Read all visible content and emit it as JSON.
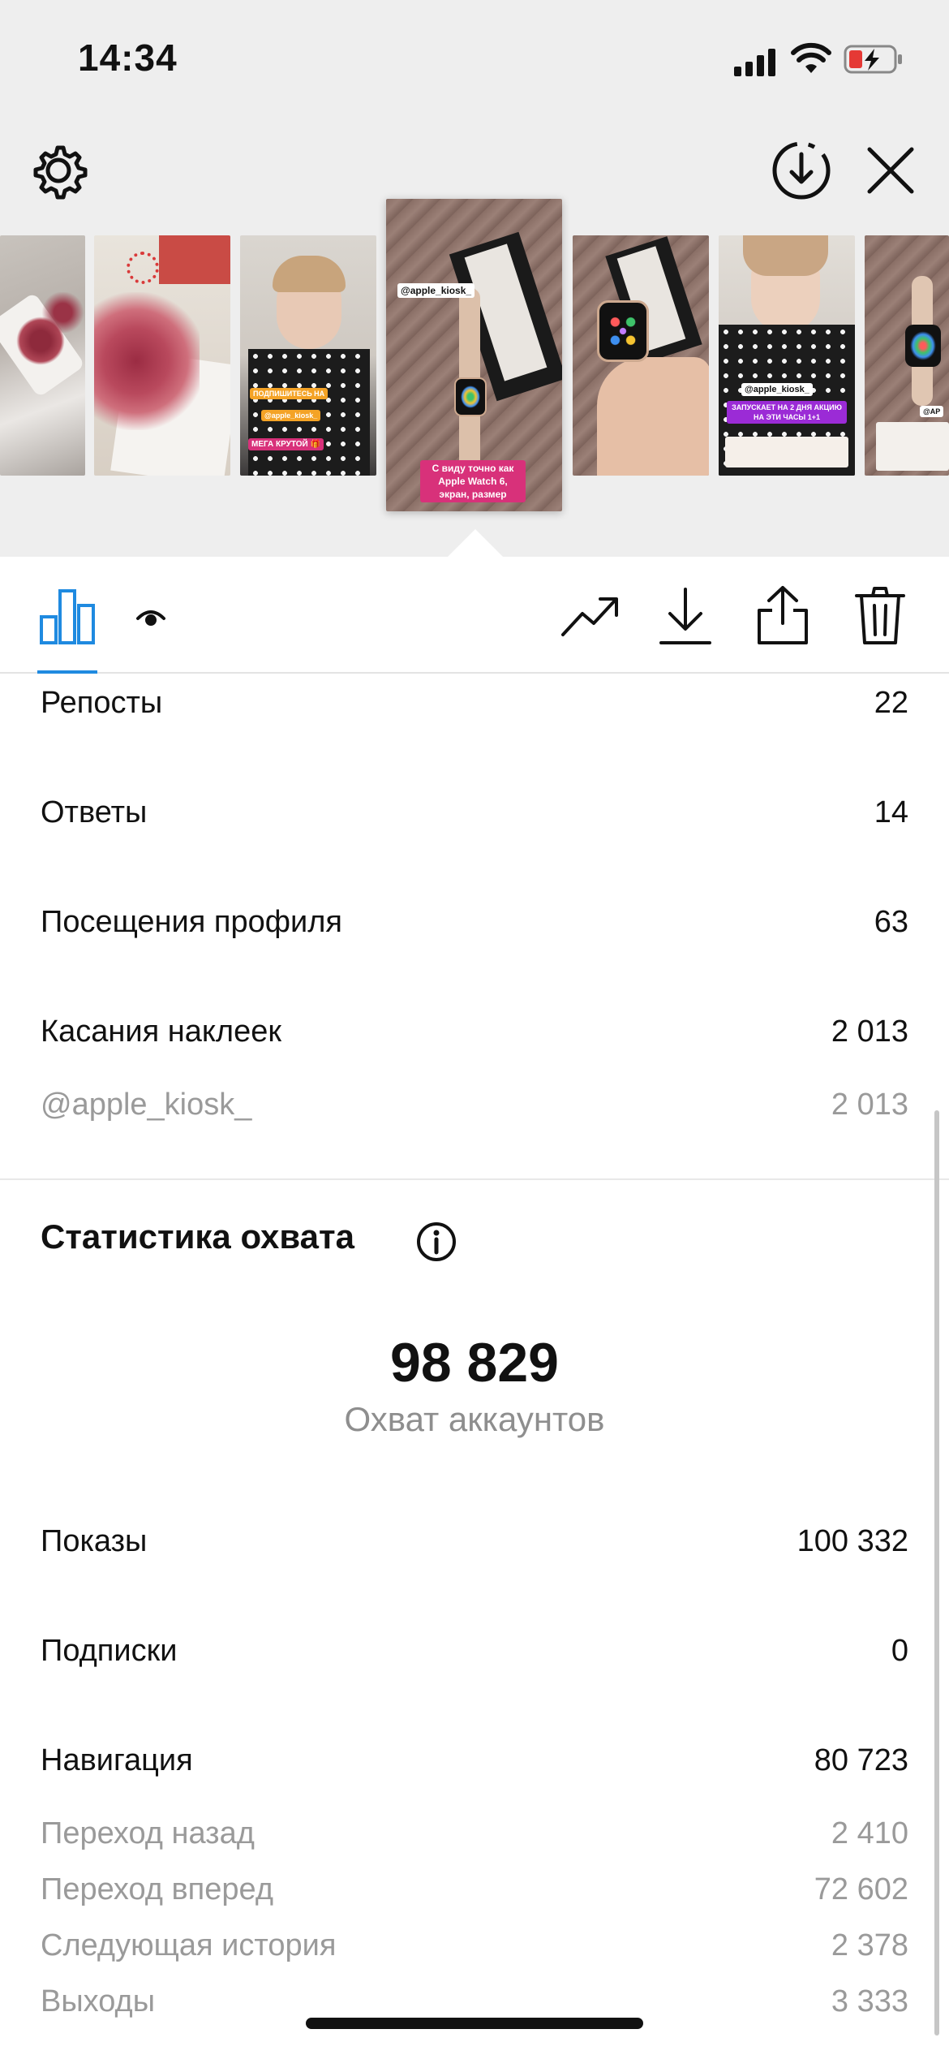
{
  "status_bar": {
    "time": "14:34"
  },
  "stories": {
    "thumbnails": [
      {
        "name": "story-thumb-1",
        "overlay": []
      },
      {
        "name": "story-thumb-2",
        "overlay": []
      },
      {
        "name": "story-thumb-3",
        "overlay": [
          "ПОДПИШИТЕСЬ НА",
          "@apple_kiosk_",
          "МЕГА КРУТОЙ 🎁"
        ]
      },
      {
        "name": "story-thumb-4-selected",
        "overlay": [
          "@apple_kiosk_",
          "С виду точно как Apple Watch 6, экран, размер"
        ]
      },
      {
        "name": "story-thumb-5",
        "overlay": []
      },
      {
        "name": "story-thumb-6",
        "overlay": [
          "@apple_kiosk_",
          "ЗАПУСКАЕТ НА 2 ДНЯ АКЦИЮ НА ЭТИ ЧАСЫ 1+1"
        ]
      },
      {
        "name": "story-thumb-7",
        "overlay": [
          "@AP"
        ]
      }
    ]
  },
  "stats": {
    "interactions": [
      {
        "label": "Репосты",
        "value": "22"
      },
      {
        "label": "Ответы",
        "value": "14"
      },
      {
        "label": "Посещения профиля",
        "value": "63"
      },
      {
        "label": "Касания наклеек",
        "value": "2 013"
      }
    ],
    "sticker_detail": {
      "label": "@apple_kiosk_",
      "value": "2 013"
    },
    "reach_section": {
      "title": "Статистика охвата",
      "accounts_reached_value": "98 829",
      "accounts_reached_caption": "Охват аккаунтов",
      "rows": [
        {
          "label": "Показы",
          "value": "100 332"
        },
        {
          "label": "Подписки",
          "value": "0"
        },
        {
          "label": "Навигация",
          "value": "80 723"
        }
      ],
      "navigation_breakdown": [
        {
          "label": "Переход назад",
          "value": "2 410"
        },
        {
          "label": "Переход вперед",
          "value": "72 602"
        },
        {
          "label": "Следующая история",
          "value": "2 378"
        },
        {
          "label": "Выходы",
          "value": "3 333"
        }
      ]
    }
  },
  "colors": {
    "accent": "#1f8ae0",
    "muted": "#9a9a9a",
    "top_bg": "#eeeeee"
  }
}
